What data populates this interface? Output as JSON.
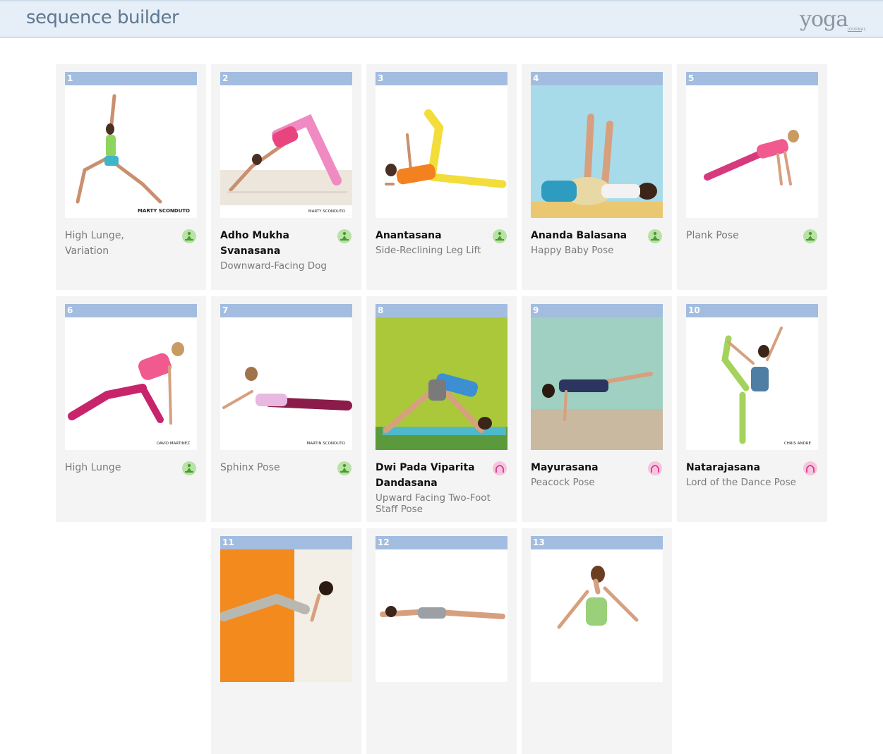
{
  "header": {
    "title": "sequence builder",
    "logo_text": "yoga",
    "logo_sub": "JOURNAL"
  },
  "colors": {
    "header_bg": "#e6eef7",
    "card_bg": "#f5f4f4",
    "number_bar": "#a3bde0",
    "badge_green": "#b8e2a6",
    "badge_pink": "#f7c4de"
  },
  "cards": [
    {
      "number": "1",
      "title": "High Lunge, Variation",
      "subtitle": "",
      "badge": "green",
      "credit": "MARTY SCONDUTO"
    },
    {
      "number": "2",
      "title": "Adho Mukha Svanasana",
      "subtitle": "Downward-Facing Dog",
      "badge": "green",
      "credit": "MARTY SCONDUTO"
    },
    {
      "number": "3",
      "title": "Anantasana",
      "subtitle": "Side-Reclining Leg Lift",
      "badge": "green",
      "credit": ""
    },
    {
      "number": "4",
      "title": "Ananda Balasana",
      "subtitle": "Happy Baby Pose",
      "badge": "green",
      "credit": ""
    },
    {
      "number": "5",
      "title": "Plank Pose",
      "subtitle": "",
      "badge": "green",
      "credit": ""
    },
    {
      "number": "6",
      "title": "High Lunge",
      "subtitle": "",
      "badge": "green",
      "credit": "DAVID MARTINEZ"
    },
    {
      "number": "7",
      "title": "Sphinx Pose",
      "subtitle": "",
      "badge": "green",
      "credit": "MARTIN SCONDUTO"
    },
    {
      "number": "8",
      "title": "Dwi Pada Viparita Dandasana",
      "subtitle": "Upward Facing Two-Foot Staff Pose",
      "badge": "pink",
      "credit": ""
    },
    {
      "number": "9",
      "title": "Mayurasana",
      "subtitle": "Peacock Pose",
      "badge": "pink",
      "credit": ""
    },
    {
      "number": "10",
      "title": "Natarajasana",
      "subtitle": "Lord of the Dance Pose",
      "badge": "pink",
      "credit": "CHRIS ANDRE"
    },
    {
      "number": "11",
      "title": "",
      "subtitle": "",
      "badge": "",
      "credit": ""
    },
    {
      "number": "12",
      "title": "",
      "subtitle": "",
      "badge": "",
      "credit": ""
    },
    {
      "number": "13",
      "title": "",
      "subtitle": "",
      "badge": "",
      "credit": ""
    }
  ]
}
